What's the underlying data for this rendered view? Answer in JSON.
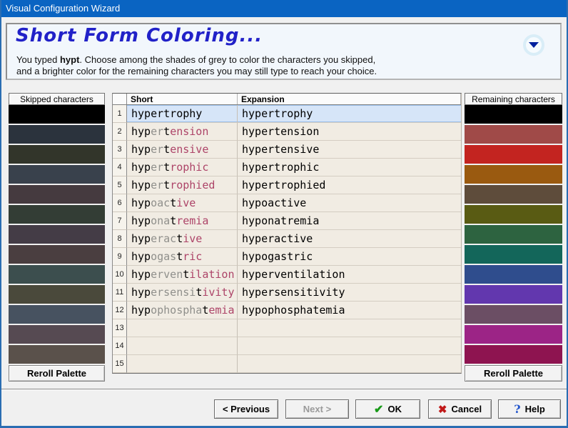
{
  "window": {
    "title": "Visual Configuration Wizard"
  },
  "header": {
    "title": "Short Form Coloring...",
    "desc1_pre": "You typed ",
    "typed_word": "hypt",
    "desc1_post": ". Choose among the shades of grey to color the characters you skipped,",
    "desc2": "and a brighter color for the remaining characters you may still type to reach your choice."
  },
  "colors": {
    "typed_text": "#000000",
    "skipped_text": "#8f8f8b",
    "remaining_text": "#ad4468",
    "selected_row_bg": "#d6e5f8",
    "title_accent": "#2121c8",
    "titlebar_bg": "#0a64c2"
  },
  "left_panel": {
    "header": "Skipped characters",
    "reroll_label": "Reroll Palette",
    "swatches": [
      "#000000",
      "#2b333d",
      "#32352a",
      "#39414c",
      "#453a3f",
      "#333d35",
      "#443c46",
      "#4a3e40",
      "#3c4e4e",
      "#4a493b",
      "#475260",
      "#564a52",
      "#5a514b"
    ]
  },
  "right_panel": {
    "header": "Remaining characters",
    "reroll_label": "Reroll Palette",
    "swatches": [
      "#000000",
      "#a04a48",
      "#c32420",
      "#9a5a10",
      "#5e4c3b",
      "#595b13",
      "#2d6340",
      "#13665a",
      "#2f4d8d",
      "#6237ae",
      "#6b4e64",
      "#9c2486",
      "#8e1450"
    ]
  },
  "table": {
    "columns": [
      "Short",
      "Expansion"
    ],
    "rows": [
      {
        "num": "1",
        "selected": true,
        "expansion": "hypertrophy",
        "segments": [
          {
            "t": "hypertrophy",
            "c": "typed_text"
          }
        ]
      },
      {
        "num": "2",
        "selected": false,
        "expansion": "hypertension",
        "segments": [
          {
            "t": "hyp",
            "c": "typed_text"
          },
          {
            "t": "er",
            "c": "skipped_text"
          },
          {
            "t": "t",
            "c": "typed_text"
          },
          {
            "t": "ension",
            "c": "remaining_text"
          }
        ]
      },
      {
        "num": "3",
        "selected": false,
        "expansion": "hypertensive",
        "segments": [
          {
            "t": "hyp",
            "c": "typed_text"
          },
          {
            "t": "er",
            "c": "skipped_text"
          },
          {
            "t": "t",
            "c": "typed_text"
          },
          {
            "t": "ensive",
            "c": "remaining_text"
          }
        ]
      },
      {
        "num": "4",
        "selected": false,
        "expansion": "hypertrophic",
        "segments": [
          {
            "t": "hyp",
            "c": "typed_text"
          },
          {
            "t": "er",
            "c": "skipped_text"
          },
          {
            "t": "t",
            "c": "typed_text"
          },
          {
            "t": "rophic",
            "c": "remaining_text"
          }
        ]
      },
      {
        "num": "5",
        "selected": false,
        "expansion": "hypertrophied",
        "segments": [
          {
            "t": "hyp",
            "c": "typed_text"
          },
          {
            "t": "er",
            "c": "skipped_text"
          },
          {
            "t": "t",
            "c": "typed_text"
          },
          {
            "t": "rophied",
            "c": "remaining_text"
          }
        ]
      },
      {
        "num": "6",
        "selected": false,
        "expansion": "hypoactive",
        "segments": [
          {
            "t": "hyp",
            "c": "typed_text"
          },
          {
            "t": "oac",
            "c": "skipped_text"
          },
          {
            "t": "t",
            "c": "typed_text"
          },
          {
            "t": "ive",
            "c": "remaining_text"
          }
        ]
      },
      {
        "num": "7",
        "selected": false,
        "expansion": "hyponatremia",
        "segments": [
          {
            "t": "hyp",
            "c": "typed_text"
          },
          {
            "t": "ona",
            "c": "skipped_text"
          },
          {
            "t": "t",
            "c": "typed_text"
          },
          {
            "t": "remia",
            "c": "remaining_text"
          }
        ]
      },
      {
        "num": "8",
        "selected": false,
        "expansion": "hyperactive",
        "segments": [
          {
            "t": "hyp",
            "c": "typed_text"
          },
          {
            "t": "erac",
            "c": "skipped_text"
          },
          {
            "t": "t",
            "c": "typed_text"
          },
          {
            "t": "ive",
            "c": "remaining_text"
          }
        ]
      },
      {
        "num": "9",
        "selected": false,
        "expansion": "hypogastric",
        "segments": [
          {
            "t": "hyp",
            "c": "typed_text"
          },
          {
            "t": "ogas",
            "c": "skipped_text"
          },
          {
            "t": "t",
            "c": "typed_text"
          },
          {
            "t": "ric",
            "c": "remaining_text"
          }
        ]
      },
      {
        "num": "10",
        "selected": false,
        "expansion": "hyperventilation",
        "segments": [
          {
            "t": "hyp",
            "c": "typed_text"
          },
          {
            "t": "erven",
            "c": "skipped_text"
          },
          {
            "t": "t",
            "c": "typed_text"
          },
          {
            "t": "ilation",
            "c": "remaining_text"
          }
        ]
      },
      {
        "num": "11",
        "selected": false,
        "expansion": "hypersensitivity",
        "segments": [
          {
            "t": "hyp",
            "c": "typed_text"
          },
          {
            "t": "ersensi",
            "c": "skipped_text"
          },
          {
            "t": "t",
            "c": "typed_text"
          },
          {
            "t": "ivity",
            "c": "remaining_text"
          }
        ]
      },
      {
        "num": "12",
        "selected": false,
        "expansion": "hypophosphatemia",
        "segments": [
          {
            "t": "hyp",
            "c": "typed_text"
          },
          {
            "t": "ophospha",
            "c": "skipped_text"
          },
          {
            "t": "t",
            "c": "typed_text"
          },
          {
            "t": "emia",
            "c": "remaining_text"
          }
        ]
      },
      {
        "num": "13",
        "selected": false,
        "expansion": "",
        "segments": []
      },
      {
        "num": "14",
        "selected": false,
        "expansion": "",
        "segments": []
      },
      {
        "num": "15",
        "selected": false,
        "expansion": "",
        "segments": []
      }
    ]
  },
  "footer": {
    "previous_label": "< Previous",
    "next_label": "Next >",
    "ok_label": "OK",
    "cancel_label": "Cancel",
    "help_label": "Help",
    "ok_icon": "✔",
    "cancel_icon": "✖",
    "help_icon": "?"
  }
}
